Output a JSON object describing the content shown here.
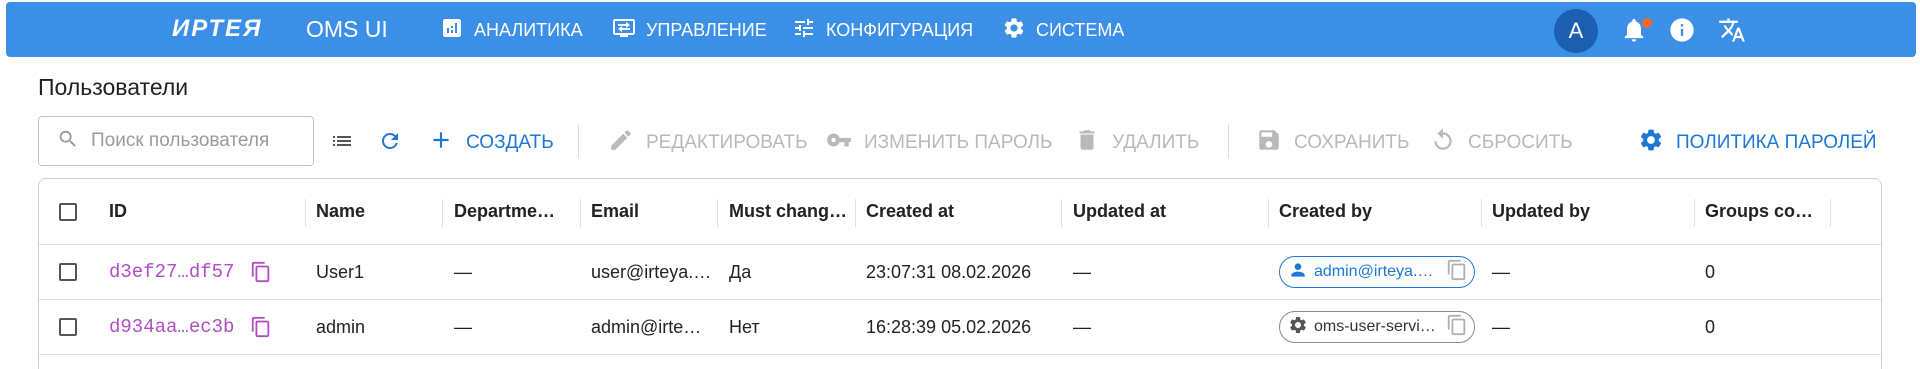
{
  "appbar": {
    "logo": "ИРТЕЯ",
    "product": "OMS UI",
    "nav": [
      {
        "label": "АНАЛИТИКА",
        "icon": "analytics-icon"
      },
      {
        "label": "УПРАВЛЕНИЕ",
        "icon": "management-icon"
      },
      {
        "label": "КОНФИГУРАЦИЯ",
        "icon": "tune-icon"
      },
      {
        "label": "СИСТЕМА",
        "icon": "gear-icon"
      }
    ],
    "avatar_letter": "A",
    "icons": [
      "bell-icon",
      "info-icon",
      "translate-icon"
    ],
    "accent": "#3b8fe6"
  },
  "page": {
    "title": "Пользователи"
  },
  "toolbar": {
    "search_placeholder": "Поиск пользователя",
    "create_label": "СОЗДАТЬ",
    "edit_label": "РЕДАКТИРОВАТЬ",
    "change_password_label": "ИЗМЕНИТЬ ПАРОЛЬ",
    "delete_label": "УДАЛИТЬ",
    "save_label": "СОХРАНИТЬ",
    "reset_label": "СБРОСИТЬ",
    "password_policy_label": "ПОЛИТИКА ПАРОЛЕЙ"
  },
  "table": {
    "columns": [
      "ID",
      "Name",
      "Departme…",
      "Email",
      "Must chang…",
      "Created at",
      "Updated at",
      "Created by",
      "Updated by",
      "Groups co…"
    ],
    "rows": [
      {
        "id": "d3ef27…df57",
        "name": "User1",
        "department": "—",
        "email": "user@irteya.…",
        "must_change": "Да",
        "created_at": "23:07:31 08.02.2026",
        "updated_at": "—",
        "created_by": "admin@irteya.…",
        "created_by_type": "user",
        "updated_by": "—",
        "groups_count": "0"
      },
      {
        "id": "d934aa…ec3b",
        "name": "admin",
        "department": "—",
        "email": "admin@irte…",
        "must_change": "Нет",
        "created_at": "16:28:39 05.02.2026",
        "updated_at": "—",
        "created_by": "oms-user-servi…",
        "created_by_type": "system",
        "updated_by": "—",
        "groups_count": "0"
      }
    ]
  }
}
